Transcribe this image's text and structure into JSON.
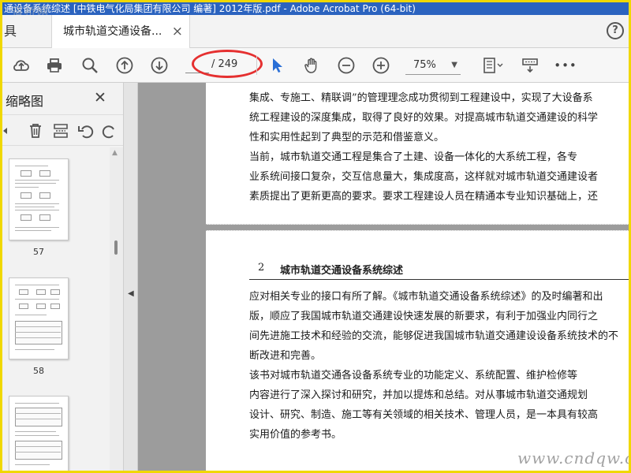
{
  "window": {
    "title": "通设备系统综述 [中铁电气化局集团有限公司 编著] 2012年版.pdf - Adobe Acrobat Pro (64-bit)",
    "watermark_top": "道桥网",
    "watermark_bottom": "www.cndqw.com",
    "highlight_color": "#e53030"
  },
  "tabs": {
    "tools_label": "具",
    "doc_tab_label": "城市轨道交通设备...",
    "doc_tab_close": "×",
    "help_label": "?"
  },
  "toolbar": {
    "icons": [
      "upload-icon",
      "print-icon",
      "search-icon",
      "page-up-icon",
      "page-down-icon",
      "select-cursor-icon",
      "hand-icon",
      "zoom-out-icon",
      "zoom-in-icon",
      "fit-page-icon",
      "scroll-mode-icon",
      "more-icon"
    ],
    "page_current": "",
    "page_total": "/ 249",
    "zoom_level": "75%",
    "more_label": "•••"
  },
  "sidebar": {
    "title": "缩略图",
    "close_label": "✕",
    "tools": [
      "options-icon",
      "delete-icon",
      "extract-icon",
      "undo-icon",
      "redo-icon"
    ],
    "thumbnails": [
      {
        "label": "57"
      },
      {
        "label": "58"
      },
      {
        "label": ""
      }
    ]
  },
  "document": {
    "page1_lines": [
      "集成、专施工、精联调”的管理理念成功贯彻到工程建设中，实现了大设备系",
      "统工程建设的深度集成，取得了良好的效果。对提高城市轨道交通建设的科学",
      "性和实用性起到了典型的示范和借鉴意义。",
      "    当前，城市轨道交通工程是集合了土建、设备一体化的大系统工程，各专",
      "业系统间接口复杂，交互信息量大，集成度高，这样就对城市轨道交通建设者",
      "素质提出了更新更高的要求。要求工程建设人员在精通本专业知识基础上，还"
    ],
    "chapter_number": "2",
    "chapter_title": "城市轨道交通设备系统综述",
    "page2_lines": [
      "应对相关专业的接口有所了解。《城市轨道交通设备系统综述》的及时编著和出",
      "版，顺应了我国城市轨道交通建设快速发展的新要求，有利于加强业内同行之",
      "间先进施工技术和经验的交流，能够促进我国城市轨道交通建设设备系统技术的不",
      "断改进和完善。",
      "    该书对城市轨道交通各设备系统专业的功能定义、系统配置、维护检修等",
      "内容进行了深入探讨和研究，并加以提炼和总结。对从事城市轨道交通规划",
      "设计、研究、制造、施工等有关领域的相关技术、管理人员，是一本具有较高",
      "实用价值的参考书。"
    ]
  }
}
